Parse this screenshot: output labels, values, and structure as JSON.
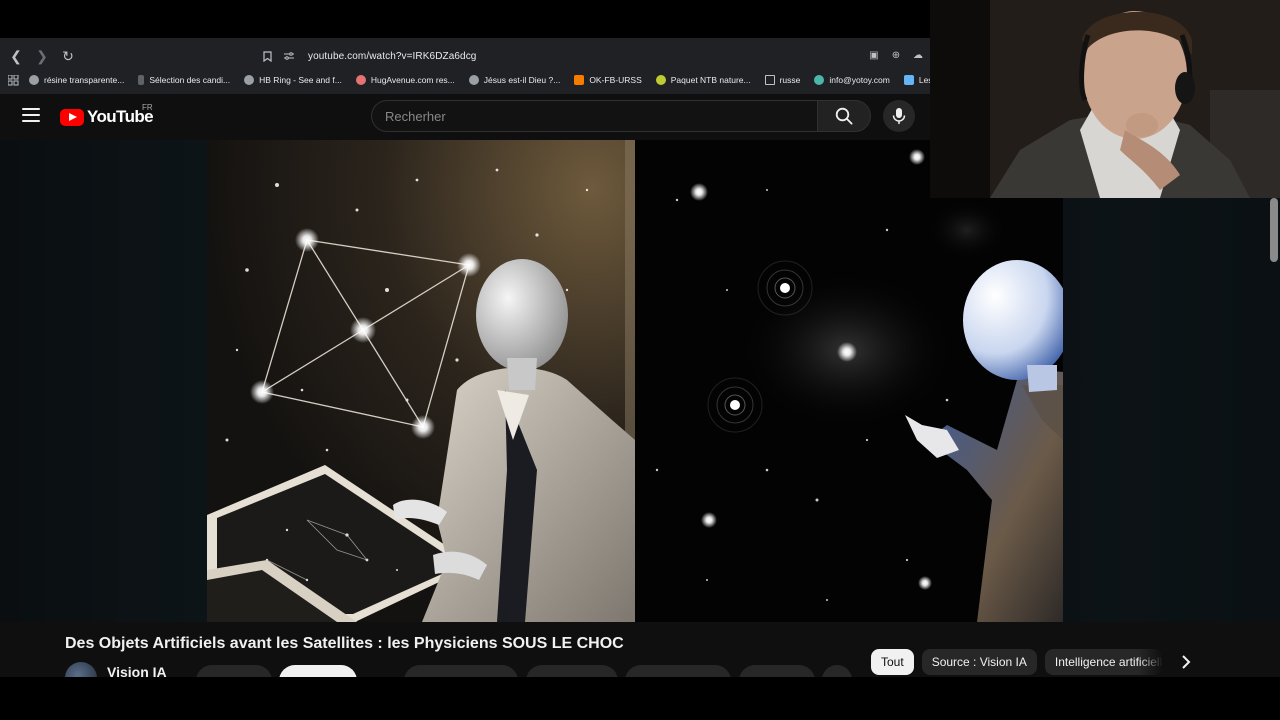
{
  "browser": {
    "url": "youtube.com/watch?v=IRK6DZa6dcg",
    "bookmarks": [
      {
        "label": "résine transparente...",
        "color": "#9aa0a6"
      },
      {
        "label": "Sélection des candi...",
        "color": "#5f6368"
      },
      {
        "label": "HB Ring - See and f...",
        "color": "#9aa0a6"
      },
      {
        "label": "HugAvenue.com res...",
        "color": "#e57373"
      },
      {
        "label": "Jésus est-il Dieu ?...",
        "color": "#9aa0a6"
      },
      {
        "label": "OK-FB-URSS",
        "color": "#f57c00"
      },
      {
        "label": "Paquet NTB nature...",
        "color": "#c0ca33"
      },
      {
        "label": "russe",
        "color": "#bdc1c6"
      },
      {
        "label": "info@yotoy.com",
        "color": "#4db6ac"
      },
      {
        "label": "Les concours d'a",
        "color": "#64b5f6"
      }
    ]
  },
  "youtube": {
    "logo_text": "YouTube",
    "country_code": "FR",
    "search_placeholder": "Recherher"
  },
  "video": {
    "title": "Des Objets Artificiels avant les Satellites : les Physiciens SOUS LE CHOC",
    "channel": "Vision IA"
  },
  "chips": [
    "Tout",
    "Source : Vision IA",
    "Intelligence artificielle"
  ],
  "colors": {
    "brand_red": "#ff0000",
    "chip_active_bg": "#f1f1f1",
    "page_bg": "#0f0f0f"
  },
  "icons": [
    "back-icon",
    "forward-icon",
    "reload-icon",
    "bookmark-icon",
    "site-settings-icon",
    "apps-icon",
    "menu-icon",
    "search-icon",
    "mic-icon",
    "chevron-right-icon"
  ]
}
